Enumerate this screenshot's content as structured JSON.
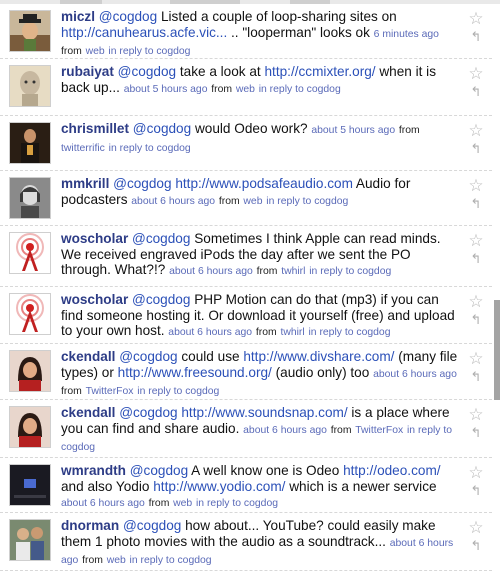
{
  "statuses": [
    {
      "user": "miczl",
      "mention": "@cogdog",
      "parts": [
        {
          "t": "text",
          "v": " Listed a couple of loop-sharing sites on "
        },
        {
          "t": "link",
          "v": "http://canuhearus.acfe.vic..."
        },
        {
          "t": "text",
          "v": " .. \"looperman\" looks ok "
        }
      ],
      "time": "6 minutes ago",
      "from_word": "from",
      "source": "web",
      "reply_to": "in reply to cogdog",
      "avatar": "man-in-hat"
    },
    {
      "user": "rubaiyat",
      "mention": "@cogdog",
      "parts": [
        {
          "t": "text",
          "v": " take a look at "
        },
        {
          "t": "link",
          "v": "http://ccmixter.org/"
        },
        {
          "t": "text",
          "v": " when it is back up... "
        }
      ],
      "time": "about 5 hours ago",
      "from_word": "from",
      "source": "web",
      "reply_to": "in reply to cogdog",
      "avatar": "bald-figure"
    },
    {
      "user": "chrismillet",
      "mention": "@cogdog",
      "parts": [
        {
          "t": "text",
          "v": " would Odeo work? "
        }
      ],
      "time": "about 5 hours ago",
      "from_word": "from",
      "source": "twitterrific",
      "reply_to": "in reply to cogdog",
      "avatar": "man-dark-suit"
    },
    {
      "user": "mmkrill",
      "mention": "@cogdog",
      "parts": [
        {
          "t": "text",
          "v": " "
        },
        {
          "t": "link",
          "v": "http://www.podsafeaudio.com"
        },
        {
          "t": "text",
          "v": " Audio for podcasters "
        }
      ],
      "time": "about 6 hours ago",
      "from_word": "from",
      "source": "web",
      "reply_to": "in reply to cogdog",
      "avatar": "woman-bw"
    },
    {
      "user": "woscholar",
      "mention": "@cogdog",
      "parts": [
        {
          "t": "text",
          "v": " Sometimes I think Apple can read minds. We received engraved iPods the day after we sent the PO through. What?!? "
        }
      ],
      "time": "about 6 hours ago",
      "from_word": "from",
      "source": "twhirl",
      "reply_to": "in reply to cogdog",
      "avatar": "radio-tower"
    },
    {
      "user": "woscholar",
      "mention": "@cogdog",
      "parts": [
        {
          "t": "text",
          "v": " PHP Motion can do that (mp3) if you can find someone hosting it. Or download it yourself (free) and upload to your own host. "
        }
      ],
      "time": "about 6 hours ago",
      "from_word": "from",
      "source": "twhirl",
      "reply_to": "in reply to cogdog",
      "avatar": "radio-tower"
    },
    {
      "user": "ckendall",
      "mention": "@cogdog",
      "parts": [
        {
          "t": "text",
          "v": " could use "
        },
        {
          "t": "link",
          "v": "http://www.divshare.com/"
        },
        {
          "t": "text",
          "v": " (many file types) or "
        },
        {
          "t": "link",
          "v": "http://www.freesound.org/"
        },
        {
          "t": "text",
          "v": " (audio only) too "
        }
      ],
      "time": "about 6 hours ago",
      "from_word": "from",
      "source": "TwitterFox",
      "reply_to": "in reply to cogdog",
      "avatar": "woman-red"
    },
    {
      "user": "ckendall",
      "mention": "@cogdog",
      "parts": [
        {
          "t": "text",
          "v": " "
        },
        {
          "t": "link",
          "v": "http://www.soundsnap.com/"
        },
        {
          "t": "text",
          "v": " is a place where you can find and share audio. "
        }
      ],
      "time": "about 6 hours ago",
      "from_word": "from",
      "source": "TwitterFox",
      "reply_to": "in reply to cogdog",
      "avatar": "woman-red"
    },
    {
      "user": "wmrandth",
      "mention": "@cogdog",
      "parts": [
        {
          "t": "text",
          "v": " A well know one is Odeo "
        },
        {
          "t": "link",
          "v": "http://odeo.com/"
        },
        {
          "t": "text",
          "v": " and also Yodio "
        },
        {
          "t": "link",
          "v": "http://www.yodio.com/"
        },
        {
          "t": "text",
          "v": " which is a newer service "
        }
      ],
      "time": "about 6 hours ago",
      "from_word": "from",
      "source": "web",
      "reply_to": "in reply to cogdog",
      "avatar": "dark-screen"
    },
    {
      "user": "dnorman",
      "mention": "@cogdog",
      "parts": [
        {
          "t": "text",
          "v": " how about... YouTube? could easily make them 1 photo movies with the audio as a soundtrack... "
        }
      ],
      "time": "about 6 hours ago",
      "from_word": "from",
      "source": "web",
      "reply_to": "in reply to cogdog",
      "avatar": "two-people"
    }
  ],
  "icons": {
    "favorite": "star-icon",
    "reply": "reply-arrow-icon"
  },
  "colors": {
    "username": "#2d3c86",
    "link": "#2b50b8",
    "meta": "#5a6ab8",
    "separator": "#d8d8d8"
  }
}
